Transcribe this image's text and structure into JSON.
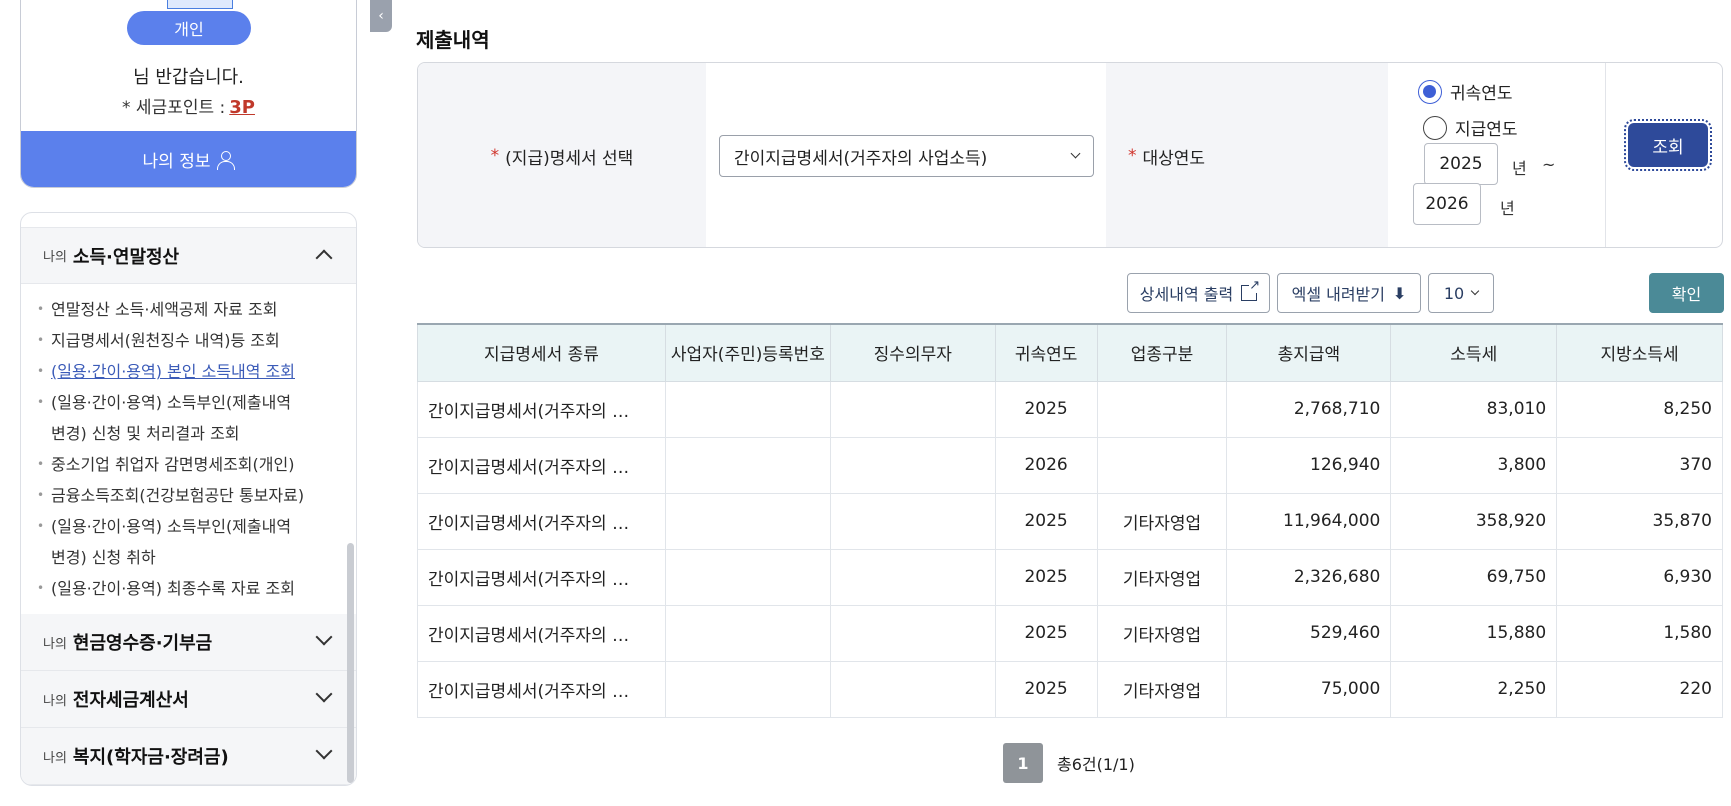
{
  "profile": {
    "badge": "개인",
    "welcome": "님 반갑습니다.",
    "points_label": "* 세금포인트 :",
    "points_value": "3P",
    "myinfo_label": "나의 정보"
  },
  "menu": {
    "sections": [
      {
        "prefix": "나의",
        "title": "소득·연말정산",
        "expanded": true
      },
      {
        "prefix": "나의",
        "title": "현금영수증·기부금",
        "expanded": false
      },
      {
        "prefix": "나의",
        "title": "전자세금계산서",
        "expanded": false
      },
      {
        "prefix": "나의",
        "title": "복지(학자금·장려금)",
        "expanded": false
      }
    ],
    "items": [
      {
        "line1": "연말정산 소득·세액공제 자료 조회",
        "line2": ""
      },
      {
        "line1": "지급명세서(원천징수 내역)등 조회",
        "line2": ""
      },
      {
        "line1": "(일용·간이·용역) 본인 소득내역 조회",
        "line2": ""
      },
      {
        "line1": "(일용·간이·용역) 소득부인(제출내역",
        "line2": "변경) 신청 및 처리결과 조회"
      },
      {
        "line1": "중소기업 취업자 감면명세조회(개인)",
        "line2": ""
      },
      {
        "line1": "금융소득조회(건강보험공단 통보자료)",
        "line2": ""
      },
      {
        "line1": "(일용·간이·용역) 소득부인(제출내역",
        "line2": "변경) 신청 취하"
      },
      {
        "line1": "(일용·간이·용역) 최종수록 자료 조회",
        "line2": ""
      }
    ]
  },
  "main": {
    "title": "제출내역",
    "search": {
      "statement_label": "(지급)명세서 선택",
      "statement_value": "간이지급명세서(거주자의 사업소득)",
      "year_label": "대상연도",
      "radio_attr_year": "귀속연도",
      "radio_pay_year": "지급연도",
      "year_from": "2025",
      "year_to": "2026",
      "unit_year": "년",
      "tilde": "~",
      "search_button": "조회"
    },
    "toolbar": {
      "detail_print": "상세내역 출력",
      "excel_download": "엑셀 내려받기",
      "page_size": "10",
      "confirm": "확인"
    },
    "table": {
      "headers": [
        "지급명세서 종류",
        "사업자(주민)등록번호",
        "징수의무자",
        "귀속연도",
        "업종구분",
        "총지급액",
        "소득세",
        "지방소득세"
      ],
      "rows": [
        {
          "type": "간이지급명세서(거주자의 …",
          "year": "2025",
          "industry": "",
          "total": "2,768,710",
          "tax": "83,010",
          "local_tax": "8,250"
        },
        {
          "type": "간이지급명세서(거주자의 …",
          "year": "2026",
          "industry": "",
          "total": "126,940",
          "tax": "3,800",
          "local_tax": "370"
        },
        {
          "type": "간이지급명세서(거주자의 …",
          "year": "2025",
          "industry": "기타자영업",
          "total": "11,964,000",
          "tax": "358,920",
          "local_tax": "35,870"
        },
        {
          "type": "간이지급명세서(거주자의 …",
          "year": "2025",
          "industry": "기타자영업",
          "total": "2,326,680",
          "tax": "69,750",
          "local_tax": "6,930"
        },
        {
          "type": "간이지급명세서(거주자의 …",
          "year": "2025",
          "industry": "기타자영업",
          "total": "529,460",
          "tax": "15,880",
          "local_tax": "1,580"
        },
        {
          "type": "간이지급명세서(거주자의 …",
          "year": "2025",
          "industry": "기타자영업",
          "total": "75,000",
          "tax": "2,250",
          "local_tax": "220"
        }
      ]
    },
    "pager": {
      "current": "1",
      "total_text": "총6건(1/1)"
    }
  }
}
